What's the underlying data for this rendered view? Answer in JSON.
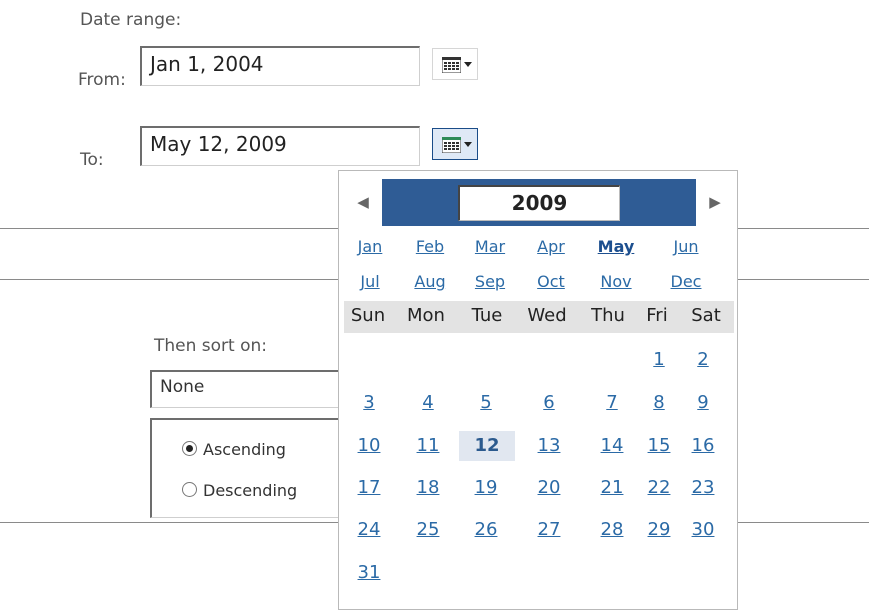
{
  "date_range": {
    "label": "Date range:",
    "from_label": "From:",
    "from_value": "Jan 1, 2004",
    "to_label": "To:",
    "to_value": "May 12, 2009"
  },
  "sort": {
    "label": "Then sort on:",
    "selected": "None",
    "ascending": "Ascending",
    "descending": "Descending"
  },
  "calendar": {
    "year": "2009",
    "prev": "◀",
    "next": "▶",
    "months": [
      "Jan",
      "Feb",
      "Mar",
      "Apr",
      "May",
      "Jun",
      "Jul",
      "Aug",
      "Sep",
      "Oct",
      "Nov",
      "Dec"
    ],
    "current_month": "May",
    "weekdays": [
      "Sun",
      "Mon",
      "Tue",
      "Wed",
      "Thu",
      "Fri",
      "Sat"
    ],
    "days": {
      "d1": "1",
      "d2": "2",
      "d3": "3",
      "d4": "4",
      "d5": "5",
      "d6": "6",
      "d7": "7",
      "d8": "8",
      "d9": "9",
      "d10": "10",
      "d11": "11",
      "d12": "12",
      "d13": "13",
      "d14": "14",
      "d15": "15",
      "d16": "16",
      "d17": "17",
      "d18": "18",
      "d19": "19",
      "d20": "20",
      "d21": "21",
      "d22": "22",
      "d23": "23",
      "d24": "24",
      "d25": "25",
      "d26": "26",
      "d27": "27",
      "d28": "28",
      "d29": "29",
      "d30": "30",
      "d31": "31"
    },
    "selected_day": "12"
  },
  "colors": {
    "accent": "#2f5c95",
    "link": "#2b6aa6"
  }
}
